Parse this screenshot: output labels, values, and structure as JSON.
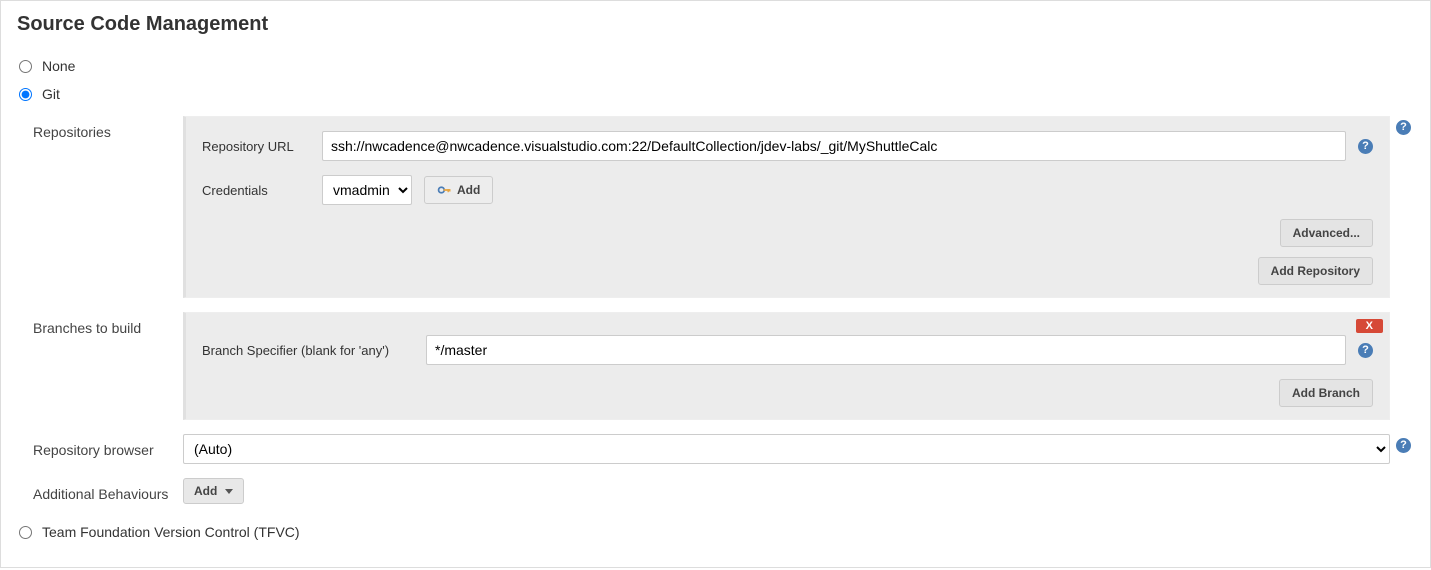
{
  "section_title": "Source Code Management",
  "scm_options": {
    "none": "None",
    "git": "Git",
    "tfvc": "Team Foundation Version Control (TFVC)"
  },
  "repositories": {
    "label": "Repositories",
    "url_label": "Repository URL",
    "url_value": "ssh://nwcadence@nwcadence.visualstudio.com:22/DefaultCollection/jdev-labs/_git/MyShuttleCalc",
    "credentials_label": "Credentials",
    "credentials_selected": "vmadmin",
    "add_credentials_label": "Add",
    "advanced_label": "Advanced...",
    "add_repo_label": "Add Repository"
  },
  "branches": {
    "label": "Branches to build",
    "specifier_label": "Branch Specifier (blank for 'any')",
    "specifier_value": "*/master",
    "delete_label": "X",
    "add_branch_label": "Add Branch"
  },
  "repo_browser": {
    "label": "Repository browser",
    "selected": "(Auto)"
  },
  "additional_behaviours": {
    "label": "Additional Behaviours",
    "add_label": "Add"
  }
}
